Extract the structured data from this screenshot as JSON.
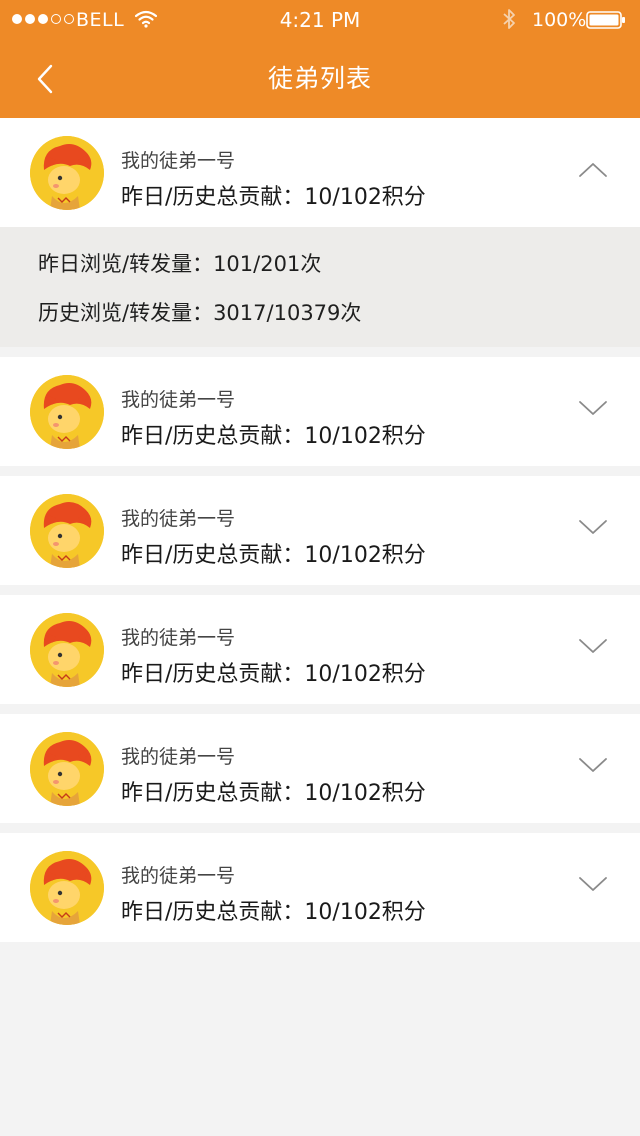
{
  "status_bar": {
    "carrier": "BELL",
    "time": "4:21 PM",
    "battery": "100%"
  },
  "header": {
    "title": "徒弟列表",
    "back_icon": "chevron-left-icon"
  },
  "apprentices": [
    {
      "name": "我的徒弟一号",
      "contribution": "昨日/历史总贡献：10/102积分",
      "expanded": true,
      "details": {
        "yesterday": "昨日浏览/转发量：101/201次",
        "history": "历史浏览/转发量：3017/10379次"
      }
    },
    {
      "name": "我的徒弟一号",
      "contribution": "昨日/历史总贡献：10/102积分",
      "expanded": false
    },
    {
      "name": "我的徒弟一号",
      "contribution": "昨日/历史总贡献：10/102积分",
      "expanded": false
    },
    {
      "name": "我的徒弟一号",
      "contribution": "昨日/历史总贡献：10/102积分",
      "expanded": false
    },
    {
      "name": "我的徒弟一号",
      "contribution": "昨日/历史总贡献：10/102积分",
      "expanded": false
    },
    {
      "name": "我的徒弟一号",
      "contribution": "昨日/历史总贡献：10/102积分",
      "expanded": false
    }
  ],
  "colors": {
    "header_bg": "#ee8a27",
    "page_bg": "#f3f3f3",
    "details_bg": "#edecea",
    "avatar_bg": "#f6c828"
  }
}
